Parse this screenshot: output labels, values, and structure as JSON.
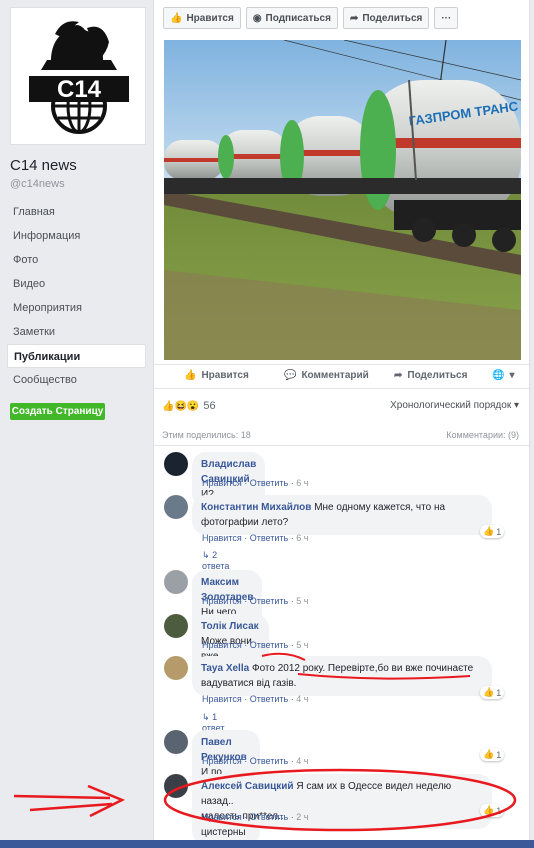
{
  "page": {
    "name": "C14 news",
    "handle": "@c14news",
    "logo_text": "C14"
  },
  "nav": [
    {
      "label": "Главная"
    },
    {
      "label": "Информация"
    },
    {
      "label": "Фото"
    },
    {
      "label": "Видео"
    },
    {
      "label": "Мероприятия"
    },
    {
      "label": "Заметки"
    },
    {
      "label": "Публикации"
    },
    {
      "label": "Сообщество"
    }
  ],
  "create_page_label": "Создать Страницу",
  "top_actions": {
    "like": "Нравится",
    "subscribe": "Подписаться",
    "share": "Поделиться",
    "more": "···"
  },
  "photo": {
    "tank_text": "ГАЗПРОМ ТРАНС"
  },
  "post_actions": {
    "like": "Нравится",
    "comment": "Комментарий",
    "share": "Поделиться"
  },
  "reactions": {
    "count": "56",
    "sort_label": "Хронологический порядок ▾"
  },
  "shares": {
    "label": "Этим поделились: 18",
    "comments": "Комментарии: (9)"
  },
  "comments": [
    {
      "author": "Владислав Савицкий",
      "text": "И?",
      "like": "Нравится",
      "reply": "Ответить",
      "time": "6 ч"
    },
    {
      "author": "Константин Михайлов",
      "text": "Мне одному кажется, что на",
      "text2": "фотографии лето?",
      "like": "Нравится",
      "reply": "Ответить",
      "time": "6 ч",
      "likes": "1",
      "replies": "2 ответа · 4 ч"
    },
    {
      "author": "Максим Золотарев",
      "text": "Ни чего личного, просто бизнес....",
      "like": "Нравится",
      "reply": "Ответить",
      "time": "5 ч"
    },
    {
      "author": "Толік Лисак",
      "text": "Може вони вже арештовані?",
      "like": "Нравится",
      "reply": "Ответить",
      "time": "5 ч"
    },
    {
      "author": "Taya Xella",
      "text": "Фото 2012 року. Перевірте,бо ви вже починаєте",
      "text2": "вадуватися від газів.",
      "like": "Нравится",
      "reply": "Ответить",
      "time": "4 ч",
      "likes": "1",
      "replies": "1 ответ"
    },
    {
      "author": "Павел Рекунков",
      "text": "И по Черкассам ганяют кацапские цистерны",
      "like": "Нравится",
      "reply": "Ответить",
      "time": "4 ч",
      "likes": "1"
    },
    {
      "author": "Алексей Савицкий",
      "text": "Я сам их в Одессе видел неделю назад..",
      "text2": "малость при**ел..",
      "like": "Нравится",
      "reply": "Ответить",
      "time": "2 ч",
      "likes": "1"
    }
  ],
  "colors": {
    "fb_blue": "#385898",
    "green": "#42b72a",
    "annotation": "#e8191f"
  }
}
